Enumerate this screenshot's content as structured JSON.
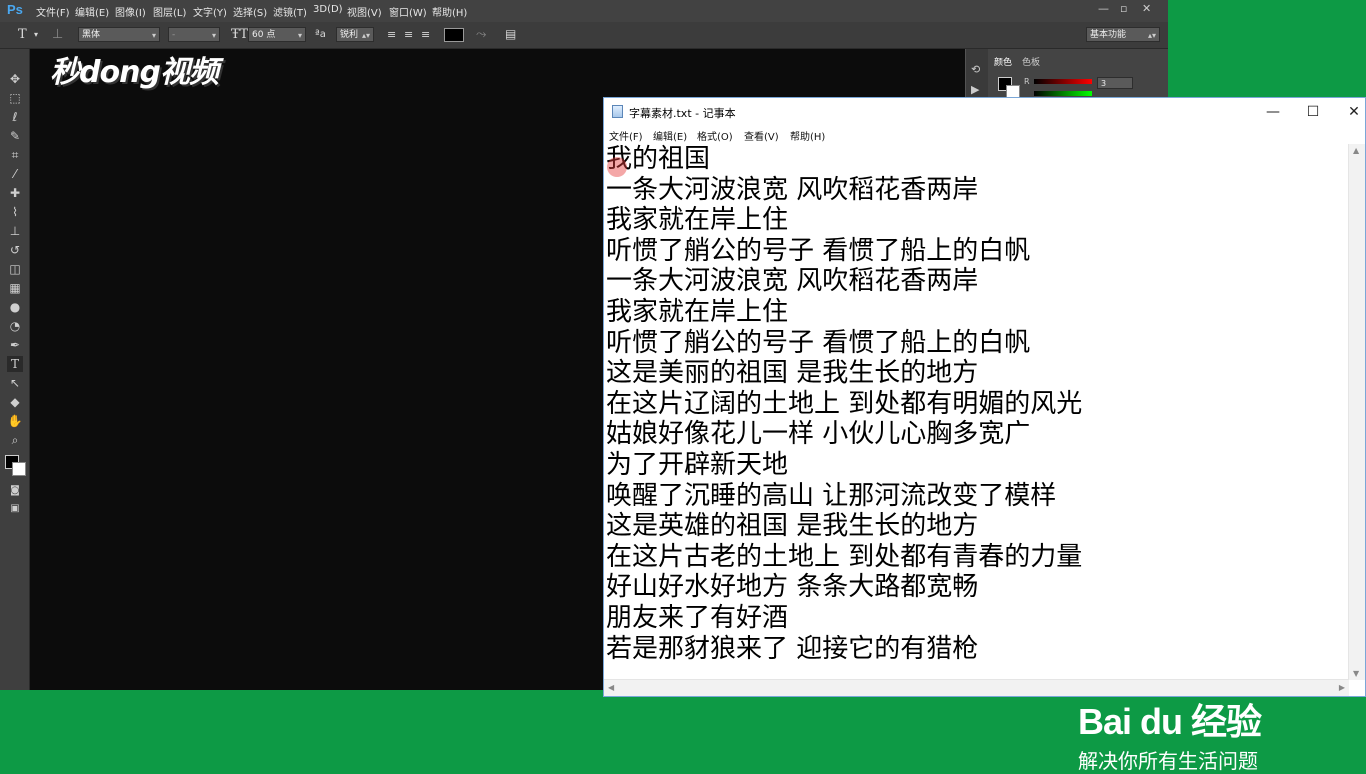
{
  "photoshop": {
    "logo": "Ps",
    "menu": [
      "文件(F)",
      "编辑(E)",
      "图像(I)",
      "图层(L)",
      "文字(Y)",
      "选择(S)",
      "滤镜(T)",
      "3D(D)",
      "视图(V)",
      "窗口(W)",
      "帮助(H)"
    ],
    "window_controls": [
      "—",
      "▫",
      "✕"
    ],
    "options": {
      "tool_icon": "type-tool-icon",
      "font_family": "黑体",
      "font_style": "-",
      "font_size": "60 点",
      "antialias_icon_text": "ªa",
      "antialias": "锐利",
      "color_swatch": "#000000",
      "workspace": "基本功能"
    },
    "panels": {
      "tabs": [
        "颜色",
        "色板"
      ],
      "r_label": "R",
      "r_value": "3"
    }
  },
  "watermark": {
    "miaodong": "秒dong视频"
  },
  "notepad": {
    "title": "字幕素材.txt - 记事本",
    "controls": [
      "—",
      "☐",
      "✕"
    ],
    "menu": [
      "文件(F)",
      "编辑(E)",
      "格式(O)",
      "查看(V)",
      "帮助(H)"
    ],
    "lines": [
      "我的祖国",
      "一条大河波浪宽 风吹稻花香两岸",
      "我家就在岸上住",
      "听惯了艄公的号子 看惯了船上的白帆",
      "一条大河波浪宽 风吹稻花香两岸",
      "我家就在岸上住",
      "听惯了艄公的号子 看惯了船上的白帆",
      "这是美丽的祖国 是我生长的地方",
      "在这片辽阔的土地上 到处都有明媚的风光",
      "姑娘好像花儿一样 小伙儿心胸多宽广",
      "为了开辟新天地",
      "唤醒了沉睡的高山 让那河流改变了模样",
      "这是英雄的祖国 是我生长的地方",
      "在这片古老的土地上 到处都有青春的力量",
      "好山好水好地方 条条大路都宽畅",
      "朋友来了有好酒",
      "若是那豺狼来了 迎接它的有猎枪"
    ]
  },
  "baidu": {
    "logo": "Bai du 经验",
    "slogan": "解决你所有生活问题"
  },
  "colors": {
    "background_green": "#0d9a45",
    "ps_canvas": "#0c0c0c",
    "ps_chrome": "#424242"
  }
}
